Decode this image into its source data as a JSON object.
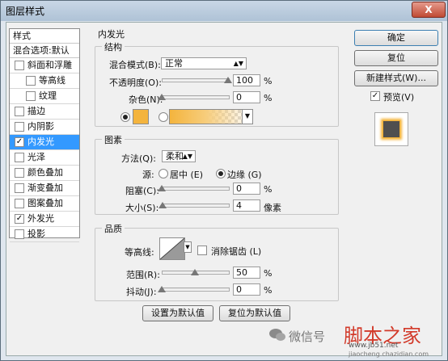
{
  "window": {
    "title": "图层样式",
    "close_label": "X"
  },
  "sidebar": {
    "header": "样式",
    "blend": "混合选项:默认",
    "items": [
      {
        "label": "斜面和浮雕",
        "checked": false,
        "sub": false,
        "selected": false
      },
      {
        "label": "等高线",
        "checked": false,
        "sub": true,
        "selected": false
      },
      {
        "label": "纹理",
        "checked": false,
        "sub": true,
        "selected": false
      },
      {
        "label": "描边",
        "checked": false,
        "sub": false,
        "selected": false
      },
      {
        "label": "内阴影",
        "checked": false,
        "sub": false,
        "selected": false
      },
      {
        "label": "内发光",
        "checked": true,
        "sub": false,
        "selected": true
      },
      {
        "label": "光泽",
        "checked": false,
        "sub": false,
        "selected": false
      },
      {
        "label": "颜色叠加",
        "checked": false,
        "sub": false,
        "selected": false
      },
      {
        "label": "渐变叠加",
        "checked": false,
        "sub": false,
        "selected": false
      },
      {
        "label": "图案叠加",
        "checked": false,
        "sub": false,
        "selected": false
      },
      {
        "label": "外发光",
        "checked": true,
        "sub": false,
        "selected": false
      },
      {
        "label": "投影",
        "checked": false,
        "sub": false,
        "selected": false
      }
    ]
  },
  "panel": {
    "title": "内发光",
    "structure": {
      "legend": "结构",
      "blend_mode_label": "混合模式(B):",
      "blend_mode_value": "正常",
      "opacity_label": "不透明度(O):",
      "opacity_value": "100",
      "opacity_fraction": 1.0,
      "noise_label": "杂色(N):",
      "noise_value": "0",
      "noise_fraction": 0,
      "percent": "%",
      "color": "#f4b43d"
    },
    "elements": {
      "legend": "图素",
      "technique_label": "方法(Q):",
      "technique_value": "柔和",
      "source_label": "源:",
      "center_label": "居中 (E)",
      "edge_label": "边缘 (G)",
      "choke_label": "阻塞(C):",
      "choke_value": "0",
      "choke_fraction": 0,
      "size_label": "大小(S):",
      "size_value": "4",
      "size_fraction": 0.016,
      "percent": "%",
      "pixels": "像素"
    },
    "quality": {
      "legend": "品质",
      "contour_label": "等高线:",
      "antialias_label": "消除锯齿 (L)",
      "range_label": "范围(R):",
      "range_value": "50",
      "range_fraction": 0.5,
      "jitter_label": "抖动(J):",
      "jitter_value": "0",
      "jitter_fraction": 0,
      "percent": "%"
    },
    "make_default": "设置为默认值",
    "reset_default": "复位为默认值"
  },
  "buttons": {
    "ok": "确定",
    "reset": "复位",
    "new_style": "新建样式(W)...",
    "preview": "预览(V)"
  },
  "watermark": {
    "wechat": "微信号",
    "brand": "脚本之家",
    "url": "www.jb51.net",
    "url2": "jiaocheng.chazidian.com"
  }
}
